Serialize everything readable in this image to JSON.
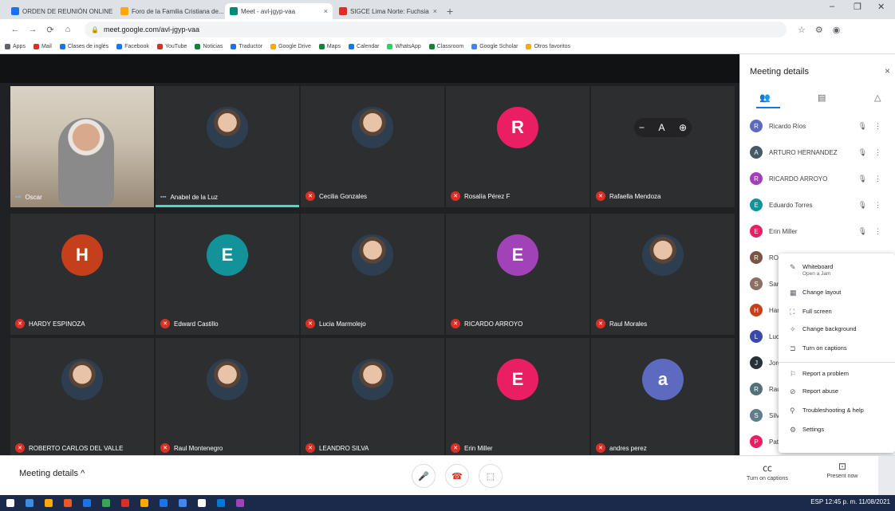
{
  "browser": {
    "tabs": [
      {
        "label": "ORDEN DE REUNIÓN ONLINE | M...",
        "color": "#1a73e8"
      },
      {
        "label": "Foro de la Familia Cristiana de...",
        "color": "#f9ab00"
      },
      {
        "label": "Meet - avl-jgyp-vaa",
        "color": "#00897b",
        "active": true
      },
      {
        "label": "SIGCE Lima Norte: Fuchsia",
        "color": "#d93025"
      }
    ],
    "new_tab": "+",
    "tab_close": "×",
    "window_controls": [
      "–",
      "❐",
      "✕"
    ],
    "nav": [
      "←",
      "→",
      "⟳",
      "⌂"
    ],
    "url": "meet.google.com/avl-jgyp-vaa",
    "addr_icons": [
      "☆",
      "⚙",
      "◉"
    ],
    "bookmarks": [
      {
        "label": "Apps",
        "color": "#5f6368"
      },
      {
        "label": "Mail",
        "color": "#d93025"
      },
      {
        "label": "Clases de inglés",
        "color": "#1a73e8"
      },
      {
        "label": "Facebook",
        "color": "#1877f2"
      },
      {
        "label": "YouTube",
        "color": "#d93025"
      },
      {
        "label": "Noticias",
        "color": "#188038"
      },
      {
        "label": "Traductor",
        "color": "#1a73e8"
      },
      {
        "label": "Google Drive",
        "color": "#f9ab00"
      },
      {
        "label": "Maps",
        "color": "#188038"
      },
      {
        "label": "Calendar",
        "color": "#1a73e8"
      },
      {
        "label": "WhatsApp",
        "color": "#25d366"
      },
      {
        "label": "Classroom",
        "color": "#188038"
      },
      {
        "label": "Google Scholar",
        "color": "#4285f4"
      },
      {
        "label": "Otros favoritos",
        "color": "#f9ab00"
      }
    ]
  },
  "tiles": [
    {
      "name": "Oscar",
      "type": "video",
      "speaking": true
    },
    {
      "name": "Anabel de la Luz",
      "type": "photo",
      "speaking": true,
      "active": true
    },
    {
      "name": "Cecilia Gonzales",
      "type": "photo"
    },
    {
      "name": "Rosalía Pérez F",
      "type": "letter",
      "letter": "R",
      "color": "#e91e63"
    },
    {
      "name": "Rafaella Mendoza",
      "type": "letter",
      "letter": "A",
      "color": "#5f6368",
      "hover": true
    },
    {
      "name": "HARDY ESPINOZA",
      "type": "letter",
      "letter": "H",
      "color": "#c5401a"
    },
    {
      "name": "Edward Castillo",
      "type": "letter",
      "letter": "E",
      "color": "#12939a"
    },
    {
      "name": "Lucia Marmolejo",
      "type": "photo"
    },
    {
      "name": "RICARDO ARROYO",
      "type": "letter",
      "letter": "E",
      "color": "#a142b8"
    },
    {
      "name": "Raul Morales",
      "type": "photo"
    },
    {
      "name": "ROBERTO CARLOS DEL VALLE",
      "type": "photo"
    },
    {
      "name": "Raul Montenegro",
      "type": "photo"
    },
    {
      "name": "LEANDRO SILVA",
      "type": "photo"
    },
    {
      "name": "Erin Miller",
      "type": "letter",
      "letter": "E",
      "color": "#e91e63"
    },
    {
      "name": "andres perez",
      "type": "letter",
      "letter": "a",
      "color": "#5c6bc0"
    }
  ],
  "bottom": {
    "meeting_details": "Meeting details",
    "chevron": "^",
    "controls": [
      "🎤",
      "☎",
      "⬚"
    ],
    "captions_label": "Turn on captions",
    "present_label": "Present now",
    "captions_icon": "㏄",
    "present_icon": "⊡"
  },
  "panel": {
    "title": "Meeting details",
    "close": "×",
    "tabs": [
      "People",
      "Chat",
      "Activities"
    ],
    "tab_icons": [
      "👥",
      "▤",
      "△"
    ],
    "participants": [
      {
        "name": "Ricardo Ríos",
        "color": "#5c6bc0",
        "letter": "R"
      },
      {
        "name": "ARTURO HERNANDEZ",
        "color": "#455a64",
        "letter": "A"
      },
      {
        "name": "RICARDO ARROYO",
        "color": "#a142b8",
        "letter": "R"
      },
      {
        "name": "Eduardo Torres",
        "color": "#12939a",
        "letter": "E"
      },
      {
        "name": "Erin Miller",
        "color": "#e91e63",
        "letter": "E"
      },
      {
        "name": "ROBERTO",
        "color": "#795548",
        "letter": "R"
      },
      {
        "name": "Sara",
        "color": "#8d6e63",
        "letter": "S"
      },
      {
        "name": "Hardy",
        "color": "#c5401a",
        "letter": "H"
      },
      {
        "name": "Lucia",
        "color": "#3949ab",
        "letter": "L"
      },
      {
        "name": "Jorge",
        "color": "#263238",
        "letter": "J"
      },
      {
        "name": "Raul",
        "color": "#546e7a",
        "letter": "R"
      },
      {
        "name": "Silvia",
        "color": "#607d8b",
        "letter": "S"
      },
      {
        "name": "Patricia",
        "color": "#e91e63",
        "letter": "P"
      }
    ],
    "mic_icon": "🎙",
    "more_icon": "⋮"
  },
  "menu": {
    "items": [
      {
        "icon": "✎",
        "label": "Whiteboard",
        "sub": "Open a Jam"
      },
      {
        "icon": "▦",
        "label": "Change layout"
      },
      {
        "icon": "⛶",
        "label": "Full screen"
      },
      {
        "icon": "✧",
        "label": "Change background"
      },
      {
        "icon": "⊐",
        "label": "Turn on captions"
      },
      {
        "icon": "⚐",
        "label": "Report a problem"
      },
      {
        "icon": "⊘",
        "label": "Report abuse"
      },
      {
        "icon": "⚲",
        "label": "Troubleshooting & help"
      },
      {
        "icon": "⚙",
        "label": "Settings"
      }
    ]
  },
  "taskbar": {
    "icons": [
      "#ffffff",
      "#3c8dde",
      "#f9ab00",
      "#e35b2d",
      "#1a73e8",
      "#34a853",
      "#d93025",
      "#f9ab00",
      "#1a73e8",
      "#4285f4",
      "#ffffff",
      "#0078d7",
      "#a142b8"
    ],
    "tray": "ESP  12:45 p. m.  11/08/2021"
  }
}
